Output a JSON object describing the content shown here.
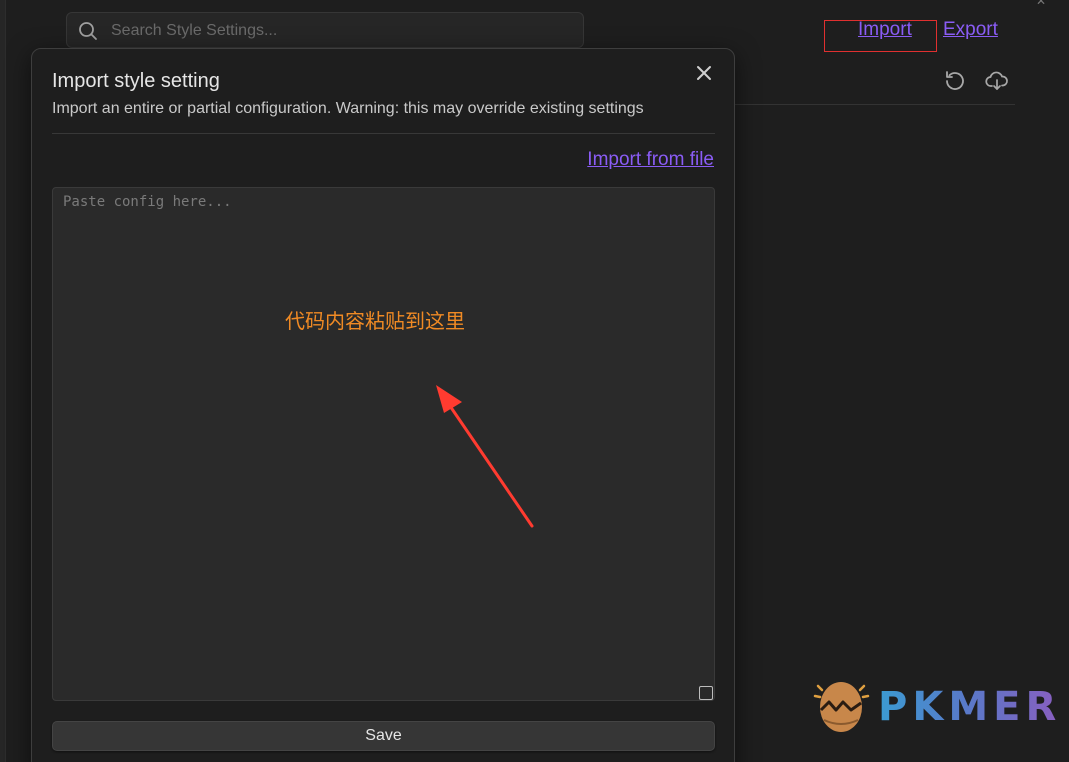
{
  "search": {
    "placeholder": "Search Style Settings..."
  },
  "header_links": {
    "import": "Import",
    "export": "Export"
  },
  "modal": {
    "title": "Import style setting",
    "description": "Import an entire or partial configuration. Warning: this may override existing settings",
    "import_from_file": "Import from file",
    "textarea_placeholder": "Paste config here...",
    "save_label": "Save"
  },
  "annotation": {
    "text": "代码内容粘贴到这里"
  },
  "watermark": {
    "text": "PKMER"
  },
  "icons": {
    "search": "search-icon",
    "reset": "reset-icon",
    "download": "download-icon",
    "close": "close-icon"
  },
  "colors": {
    "link": "#8a5cf5",
    "highlight": "#e03030",
    "annotation": "#f08a24",
    "arrow": "#ff3b30"
  }
}
